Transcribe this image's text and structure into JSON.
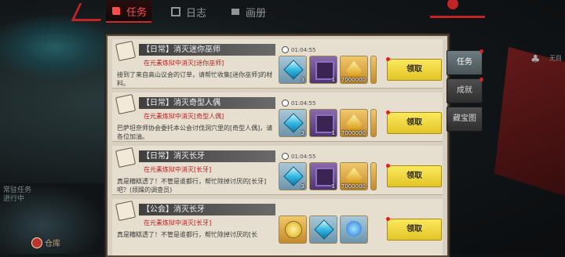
{
  "top_tabs": [
    {
      "label": "任务",
      "icon": "quest-scroll-icon",
      "active": true
    },
    {
      "label": "日志",
      "icon": "journal-icon",
      "active": false
    },
    {
      "label": "画册",
      "icon": "album-icon",
      "active": false
    }
  ],
  "side_tabs": [
    {
      "label": "任务",
      "active": true
    },
    {
      "label": "成就",
      "active": false
    },
    {
      "label": "藏宝图",
      "active": false
    }
  ],
  "quests": [
    {
      "title": "【日常】消灭迷你巫师",
      "subtitle": "在元素炼狱中消灭[迷你巫师]",
      "description": "接到了来自高山议会的订单，请帮忙收集[迷你巫师]的材料。",
      "timer": "01:04:55",
      "rewards": [
        {
          "icon": "blue-crystal-icon",
          "qty": "3"
        },
        {
          "icon": "purple-spellbook-icon",
          "qty": "1"
        },
        {
          "icon": "gold-pile-icon",
          "qty": "7000000"
        }
      ],
      "claim_label": "领取"
    },
    {
      "title": "【日常】消灭奇型人偶",
      "subtitle": "在元素炼狱中消灭[奇型人偶]",
      "description": "巴萨坦奈师协会委托本公会讨伐洞穴里的[奇型人偶]，请各位加油。",
      "timer": "01:04:55",
      "rewards": [
        {
          "icon": "blue-crystal-icon",
          "qty": "3"
        },
        {
          "icon": "purple-spellbook-icon",
          "qty": "1"
        },
        {
          "icon": "gold-pile-icon",
          "qty": "7000000"
        }
      ],
      "claim_label": "领取"
    },
    {
      "title": "【日常】消灭长牙",
      "subtitle": "在元素炼狱中消灭[长牙]",
      "description": "真是糟糕透了！不管是谁都行，帮忙除掉讨厌的[长牙]吧？(烦躁的调查员)",
      "timer": "01:04:55",
      "rewards": [
        {
          "icon": "blue-crystal-icon",
          "qty": "3"
        },
        {
          "icon": "purple-spellbook-icon",
          "qty": "1"
        },
        {
          "icon": "gold-pile-icon",
          "qty": "7000000"
        }
      ],
      "claim_label": "领取"
    },
    {
      "title": "【公会】消灭长牙",
      "subtitle": "在元素炼狱中消灭[长牙]",
      "description": "真是糟糕透了！不管是谁都行，帮忙除掉讨厌的[长",
      "timer": "",
      "rewards": [
        {
          "icon": "gold-coin-icon",
          "qty": ""
        },
        {
          "icon": "blue-crystal-icon",
          "qty": ""
        },
        {
          "icon": "blue-orb-icon",
          "qty": ""
        }
      ],
      "claim_label": "领取"
    }
  ],
  "left_chat": "常驻任务进行中",
  "warehouse_label": "仓库",
  "side_partial_label": "无目"
}
